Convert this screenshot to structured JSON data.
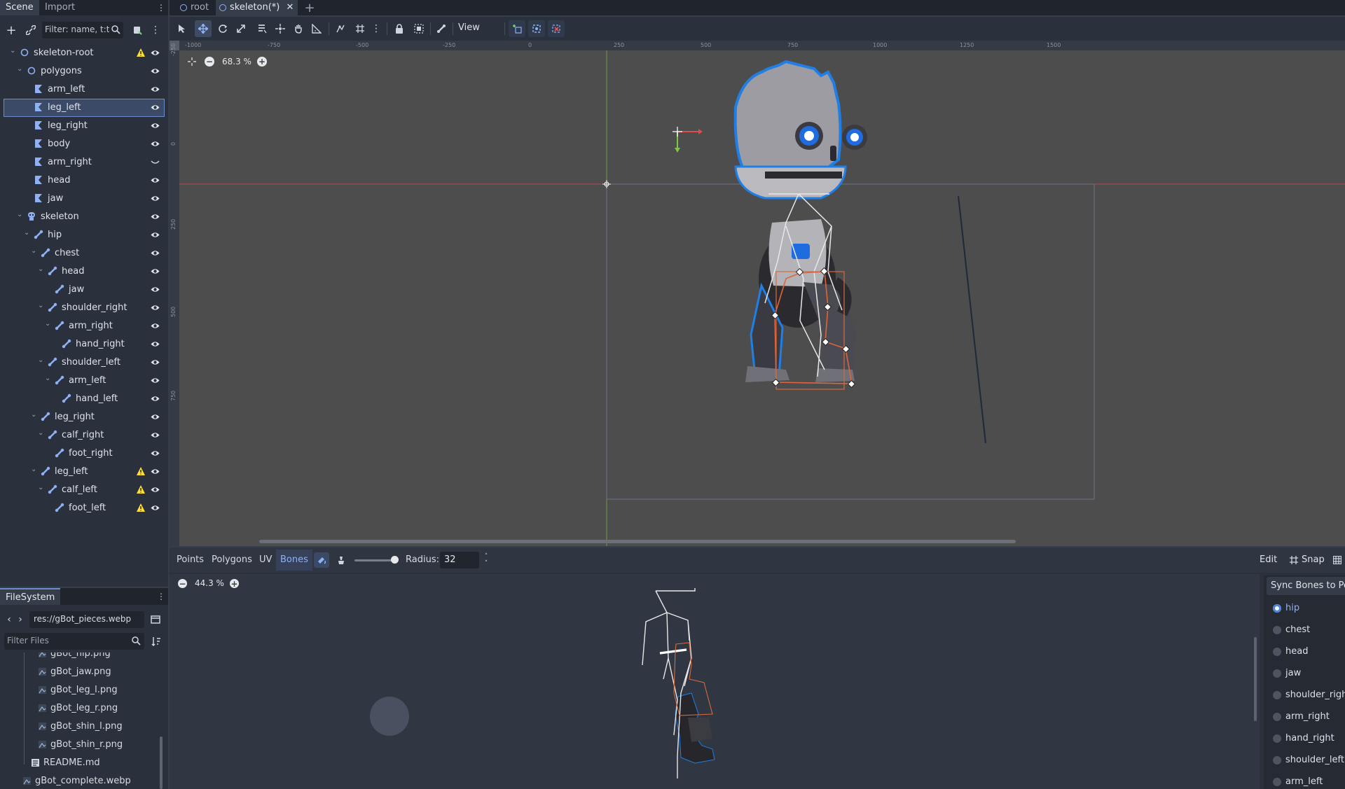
{
  "scene_dock": {
    "tabs": [
      "Scene",
      "Import"
    ],
    "filter_placeholder": "Filter: name, t:type",
    "tree": [
      {
        "label": "skeleton-root",
        "icon": "node2d-icon",
        "depth": 0,
        "chevron": "down",
        "warn": true
      },
      {
        "label": "polygons",
        "icon": "node2d-icon",
        "depth": 1,
        "chevron": "down",
        "warn": false
      },
      {
        "label": "arm_left",
        "icon": "polygon2d-icon",
        "depth": 2,
        "warn": false
      },
      {
        "label": "leg_left",
        "icon": "polygon2d-icon",
        "depth": 2,
        "warn": false,
        "selected": true
      },
      {
        "label": "leg_right",
        "icon": "polygon2d-icon",
        "depth": 2,
        "warn": false
      },
      {
        "label": "body",
        "icon": "polygon2d-icon",
        "depth": 2,
        "warn": false
      },
      {
        "label": "arm_right",
        "icon": "polygon2d-icon",
        "depth": 2,
        "warn": false,
        "hidden": true
      },
      {
        "label": "head",
        "icon": "polygon2d-icon",
        "depth": 2,
        "warn": false
      },
      {
        "label": "jaw",
        "icon": "polygon2d-icon",
        "depth": 2,
        "warn": false
      },
      {
        "label": "skeleton",
        "icon": "skeleton2d-icon",
        "depth": 1,
        "chevron": "down",
        "warn": false
      },
      {
        "label": "hip",
        "icon": "bone2d-icon",
        "depth": 2,
        "chevron": "down",
        "warn": false
      },
      {
        "label": "chest",
        "icon": "bone2d-icon",
        "depth": 3,
        "chevron": "down",
        "warn": false
      },
      {
        "label": "head",
        "icon": "bone2d-icon",
        "depth": 4,
        "chevron": "down",
        "warn": false
      },
      {
        "label": "jaw",
        "icon": "bone2d-icon",
        "depth": 5,
        "warn": false
      },
      {
        "label": "shoulder_right",
        "icon": "bone2d-icon",
        "depth": 4,
        "chevron": "down",
        "warn": false
      },
      {
        "label": "arm_right",
        "icon": "bone2d-icon",
        "depth": 5,
        "chevron": "down",
        "warn": false
      },
      {
        "label": "hand_right",
        "icon": "bone2d-icon",
        "depth": 6,
        "warn": false
      },
      {
        "label": "shoulder_left",
        "icon": "bone2d-icon",
        "depth": 4,
        "chevron": "down",
        "warn": false
      },
      {
        "label": "arm_left",
        "icon": "bone2d-icon",
        "depth": 5,
        "chevron": "down",
        "warn": false
      },
      {
        "label": "hand_left",
        "icon": "bone2d-icon",
        "depth": 6,
        "warn": false
      },
      {
        "label": "leg_right",
        "icon": "bone2d-icon",
        "depth": 3,
        "chevron": "down",
        "warn": false
      },
      {
        "label": "calf_right",
        "icon": "bone2d-icon",
        "depth": 4,
        "chevron": "down",
        "warn": false
      },
      {
        "label": "foot_right",
        "icon": "bone2d-icon",
        "depth": 5,
        "warn": false
      },
      {
        "label": "leg_left",
        "icon": "bone2d-icon",
        "depth": 3,
        "chevron": "down",
        "warn": true
      },
      {
        "label": "calf_left",
        "icon": "bone2d-icon",
        "depth": 4,
        "chevron": "down",
        "warn": true
      },
      {
        "label": "foot_left",
        "icon": "bone2d-icon",
        "depth": 5,
        "warn": true
      }
    ]
  },
  "filesystem_dock": {
    "tab": "FileSystem",
    "path": "res://gBot_pieces.webp",
    "filter_placeholder": "Filter Files",
    "files": [
      {
        "label": "gBot_hip.png",
        "icon": "image-file-icon"
      },
      {
        "label": "gBot_jaw.png",
        "icon": "image-file-icon"
      },
      {
        "label": "gBot_leg_l.png",
        "icon": "image-file-icon"
      },
      {
        "label": "gBot_leg_r.png",
        "icon": "image-file-icon"
      },
      {
        "label": "gBot_shin_l.png",
        "icon": "image-file-icon"
      },
      {
        "label": "gBot_shin_r.png",
        "icon": "image-file-icon"
      },
      {
        "label": "README.md",
        "icon": "text-file-icon"
      },
      {
        "label": "gBot_complete.webp",
        "icon": "image-file-icon"
      }
    ]
  },
  "editor_tabs": {
    "tabs": [
      {
        "label": "root",
        "active": false
      },
      {
        "label": "skeleton(*)",
        "active": true
      }
    ]
  },
  "toolbar": {
    "view_label": "View"
  },
  "viewport": {
    "zoom": "68.3 %",
    "ruler_top": [
      "-1000",
      "-750",
      "-500",
      "-250",
      "0",
      "250",
      "500",
      "750",
      "1000",
      "1250",
      "1500"
    ],
    "ruler_left": [
      "-250",
      "0",
      "250",
      "500",
      "750"
    ]
  },
  "bottom_panel": {
    "tabs": [
      "Points",
      "Polygons",
      "UV",
      "Bones"
    ],
    "active_tab": "Bones",
    "radius_label": "Radius:",
    "radius_value": "32",
    "edit_label": "Edit",
    "snap_label": "Snap",
    "zoom": "44.3 %",
    "sync_button": "Sync Bones to Polygon",
    "bones": [
      {
        "label": "hip",
        "checked": true
      },
      {
        "label": "chest",
        "checked": false
      },
      {
        "label": "head",
        "checked": false
      },
      {
        "label": "jaw",
        "checked": false
      },
      {
        "label": "shoulder_right",
        "checked": false
      },
      {
        "label": "arm_right",
        "checked": false
      },
      {
        "label": "hand_right",
        "checked": false
      },
      {
        "label": "shoulder_left",
        "checked": false
      },
      {
        "label": "arm_left",
        "checked": false
      }
    ]
  },
  "colors": {
    "accent": "#6d8cc9",
    "warning": "#ffdd33",
    "polygon_outline": "#e0643a",
    "bone_icon": "#8fb1f2"
  }
}
